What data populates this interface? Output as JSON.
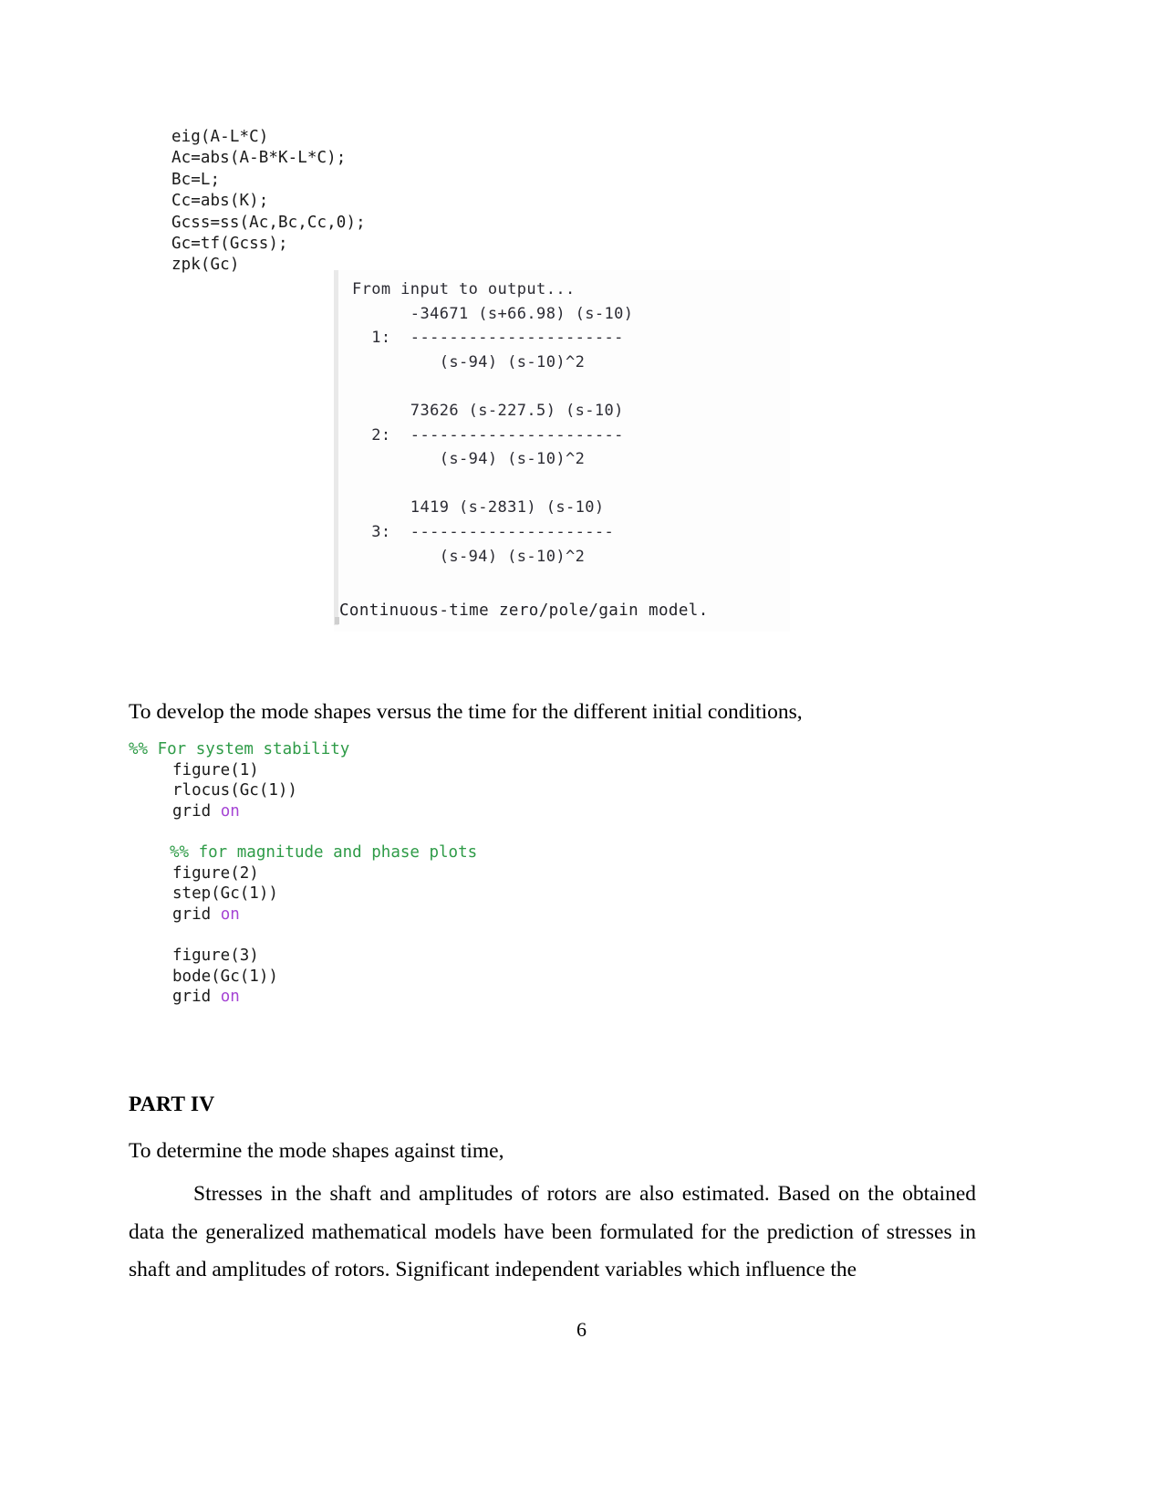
{
  "document": {
    "page_number": "6",
    "colors": {
      "text": "#000000",
      "code_text": "#1a1a1a",
      "comment_green": "#2e9b47",
      "keyword_purple": "#a544d4",
      "console_text": "#2b2b33",
      "console_rail": "#e9e9e9"
    }
  },
  "code_top": {
    "lines": [
      "eig(A-L*C)",
      "Ac=abs(A-B*K-L*C);",
      "Bc=L;",
      "Cc=abs(K);",
      "Gcss=ss(Ac,Bc,Cc,0);",
      "Gc=tf(Gcss);",
      "zpk(Gc)"
    ]
  },
  "console_output": {
    "header": "From input to output...",
    "lines": [
      "From input to output...",
      "      -34671 (s+66.98) (s-10)",
      "  1:  ----------------------",
      "         (s-94) (s-10)^2",
      "",
      "      73626 (s-227.5) (s-10)",
      "  2:  ----------------------",
      "         (s-94) (s-10)^2",
      "",
      "      1419 (s-2831) (s-10)",
      "  3:  ---------------------",
      "         (s-94) (s-10)^2"
    ],
    "footer": "Continuous-time zero/pole/gain model.",
    "transfer_functions": [
      {
        "index": "1:",
        "numerator": "-34671 (s+66.98) (s-10)",
        "divider": "----------------------",
        "denominator": "(s-94) (s-10)^2"
      },
      {
        "index": "2:",
        "numerator": "73626 (s-227.5) (s-10)",
        "divider": "----------------------",
        "denominator": "(s-94) (s-10)^2"
      },
      {
        "index": "3:",
        "numerator": "1419 (s-2831) (s-10)",
        "divider": "---------------------",
        "denominator": "(s-94) (s-10)^2"
      }
    ]
  },
  "body": {
    "intro_paragraph": "To develop the mode shapes versus the time for the different initial conditions,",
    "part_heading": "PART IV",
    "determine_paragraph": "To determine the mode shapes against time,",
    "stresses_paragraph": "Stresses in the shaft and amplitudes of rotors are also estimated. Based on the obtained data the generalized mathematical models have been formulated for the prediction of stresses in shaft and amplitudes of rotors. Significant independent variables which influence the"
  },
  "code_main": {
    "lines": [
      {
        "indent": 0,
        "comment": "%% For system stability",
        "code": "",
        "keyword": ""
      },
      {
        "indent": 48,
        "comment": "",
        "code": "figure(1)",
        "keyword": ""
      },
      {
        "indent": 48,
        "comment": "",
        "code": "rlocus(Gc(1))",
        "keyword": ""
      },
      {
        "indent": 48,
        "comment": "",
        "code": "grid ",
        "keyword": "on"
      },
      {
        "indent": 0,
        "comment": "",
        "code": "",
        "keyword": ""
      },
      {
        "indent": 45,
        "comment": "%% for magnitude and phase plots",
        "code": "",
        "keyword": ""
      },
      {
        "indent": 48,
        "comment": "",
        "code": "figure(2)",
        "keyword": ""
      },
      {
        "indent": 48,
        "comment": "",
        "code": "step(Gc(1))",
        "keyword": ""
      },
      {
        "indent": 48,
        "comment": "",
        "code": "grid ",
        "keyword": "on"
      },
      {
        "indent": 0,
        "comment": "",
        "code": "",
        "keyword": ""
      },
      {
        "indent": 48,
        "comment": "",
        "code": "figure(3)",
        "keyword": ""
      },
      {
        "indent": 48,
        "comment": "",
        "code": "bode(Gc(1))",
        "keyword": ""
      },
      {
        "indent": 48,
        "comment": "",
        "code": "grid ",
        "keyword": "on"
      }
    ]
  }
}
